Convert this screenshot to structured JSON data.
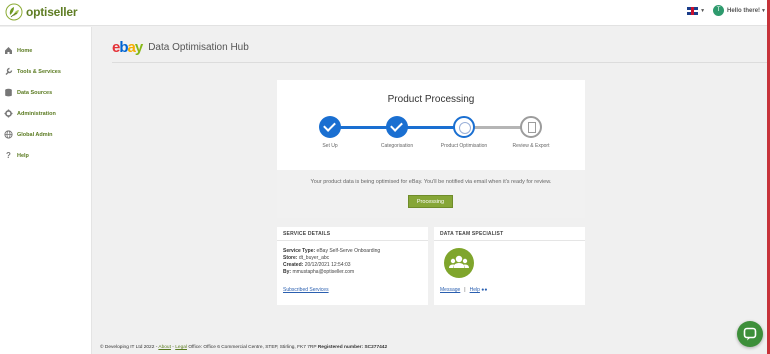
{
  "brand": {
    "name": "optiseller"
  },
  "topbar": {
    "greeting": "Hello there!",
    "avatar_initial": "T"
  },
  "sidebar": {
    "items": [
      {
        "label": "Home",
        "icon": "home-icon"
      },
      {
        "label": "Tools & Services",
        "icon": "wrench-icon"
      },
      {
        "label": "Data Sources",
        "icon": "database-icon"
      },
      {
        "label": "Administration",
        "icon": "gear-icon"
      },
      {
        "label": "Global Admin",
        "icon": "globe-icon"
      },
      {
        "label": "Help",
        "icon": "question-icon"
      }
    ]
  },
  "header": {
    "ebay": {
      "e": "e",
      "b": "b",
      "a": "a",
      "y": "y"
    },
    "title": "Data Optimisation Hub"
  },
  "processing": {
    "title": "Product Processing",
    "steps": [
      {
        "label": "Set Up",
        "state": "done"
      },
      {
        "label": "Categorisation",
        "state": "done"
      },
      {
        "label": "Product Optimisation",
        "state": "active"
      },
      {
        "label": "Review & Export",
        "state": "todo"
      }
    ],
    "notice": "Your product data is being optimised for eBay. You'll be notified via email when it's ready for review.",
    "button": "Processing"
  },
  "service_details": {
    "heading": "SERVICE DETAILS",
    "type_label": "Service Type:",
    "type_value": "eBay Self-Serve Onboarding",
    "store_label": "Store:",
    "store_value": "dt_buyer_abc",
    "created_label": "Created:",
    "created_value": "20/12/2021 12:54:03",
    "by_label": "By:",
    "by_value": "mmustapha@optiseller.com",
    "link": "Subscribed Services"
  },
  "specialist": {
    "heading": "DATA TEAM SPECIALIST",
    "message": "Message",
    "separator": "|",
    "help": "Help"
  },
  "footer": {
    "copyright": "© Developing IT Ltd 2022 -",
    "about": "About",
    "sep": "-",
    "legal": "Legal",
    "address": "Office: Office 6 Commercial Centre, STEP, Stirling, FK7 7RP",
    "reg": "Registered number: SC277442"
  },
  "colors": {
    "accent": "#5a7a20",
    "step_blue": "#1a6fd1",
    "button": "#86a637"
  }
}
